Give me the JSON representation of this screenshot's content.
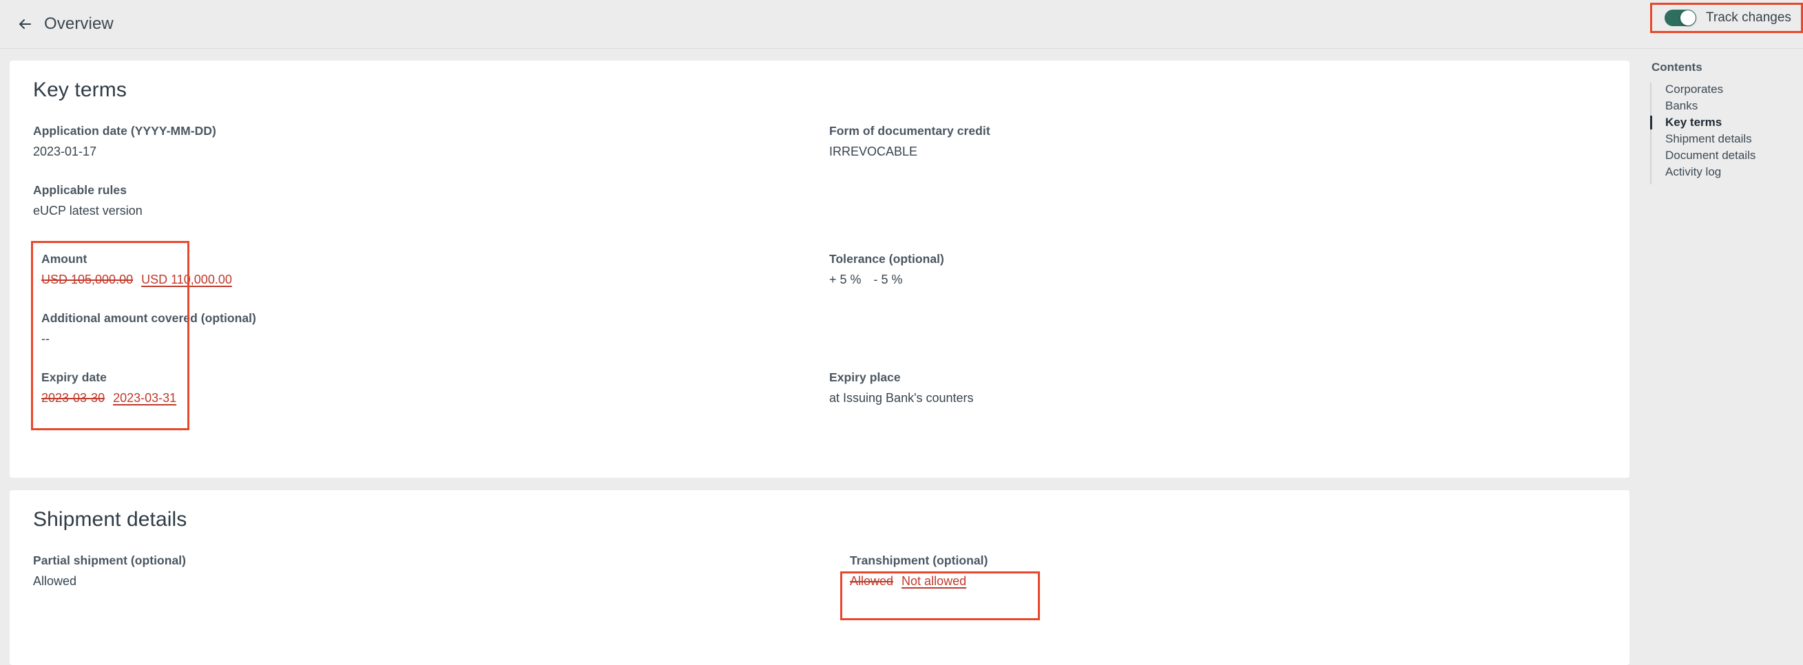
{
  "header": {
    "back_icon": "arrow-left-icon",
    "title": "Overview",
    "track_changes": {
      "label": "Track changes",
      "enabled": true,
      "track_color": "#2e6e5e",
      "annotation_color": "#e8472b"
    }
  },
  "contents": {
    "heading": "Contents",
    "items": [
      {
        "label": "Corporates",
        "active": false
      },
      {
        "label": "Banks",
        "active": false
      },
      {
        "label": "Key terms",
        "active": true
      },
      {
        "label": "Shipment details",
        "active": false
      },
      {
        "label": "Document details",
        "active": false
      },
      {
        "label": "Activity log",
        "active": false
      }
    ]
  },
  "key_terms": {
    "title": "Key terms",
    "fields": {
      "application_date": {
        "label": "Application date (YYYY-MM-DD)",
        "value": "2023-01-17"
      },
      "applicable_rules": {
        "label": "Applicable rules",
        "value": "eUCP latest version"
      },
      "amount": {
        "label": "Amount",
        "old_value": "USD 105,000.00",
        "new_value": "USD 110,000.00",
        "changed": true
      },
      "additional_amount": {
        "label": "Additional amount covered (optional)",
        "value": "--"
      },
      "expiry_date": {
        "label": "Expiry date",
        "old_value": "2023-03-30",
        "new_value": "2023-03-31",
        "changed": true
      },
      "form_of_credit": {
        "label": "Form of documentary credit",
        "value": "IRREVOCABLE"
      },
      "tolerance": {
        "label": "Tolerance (optional)",
        "plus": "+ 5 %",
        "minus": "- 5 %"
      },
      "expiry_place": {
        "label": "Expiry place",
        "value": "at Issuing Bank's counters"
      }
    }
  },
  "shipment_details": {
    "title": "Shipment details",
    "fields": {
      "partial_shipment": {
        "label": "Partial shipment (optional)",
        "value": "Allowed"
      },
      "transhipment": {
        "label": "Transhipment (optional)",
        "old_value": "Allowed",
        "new_value": "Not allowed",
        "changed": true
      }
    }
  }
}
